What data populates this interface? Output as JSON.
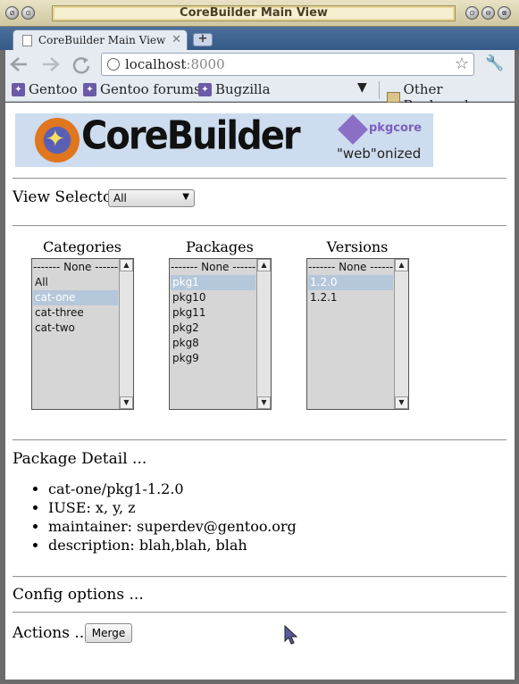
{
  "window": {
    "title": "CoreBuilder Main View",
    "wm_left_buttons": [
      "⊘",
      "⊙"
    ],
    "wm_right_buttons": [
      "⊙",
      "⊖",
      "⊗"
    ]
  },
  "tab": {
    "title": "CoreBuilder Main View",
    "close": "✕"
  },
  "newtab": {
    "label": "+"
  },
  "toolbar": {
    "url_host": "localhost",
    "url_port": ":8000",
    "back_icon": "back-arrow-icon",
    "forward_icon": "forward-arrow-icon",
    "reload_icon": "reload-icon"
  },
  "bookmarks": {
    "items": [
      "Gentoo",
      "Gentoo forums",
      "Bugzilla"
    ],
    "overflow": "▼",
    "other": "Other Bookmarks"
  },
  "banner": {
    "brand": "CoreBuilder",
    "pkgcore": "pkgcore",
    "tagline": "\"web\"onized"
  },
  "view_selector": {
    "label": "View Selector",
    "value": "All"
  },
  "categories": {
    "header": "Categories",
    "options": [
      "------- None -------",
      "All",
      "cat-one",
      "cat-three",
      "cat-two"
    ],
    "selected": "cat-one"
  },
  "packages": {
    "header": "Packages",
    "options": [
      "------- None -------",
      "pkg1",
      "pkg10",
      "pkg11",
      "pkg2",
      "pkg8",
      "pkg9"
    ],
    "selected": "pkg1"
  },
  "versions": {
    "header": "Versions",
    "options": [
      "------- None -------",
      "1.2.0",
      "1.2.1"
    ],
    "selected": "1.2.0"
  },
  "package_detail": {
    "heading": "Package Detail ...",
    "items": [
      "cat-one/pkg1-1.2.0",
      "IUSE: x, y, z",
      "maintainer: superdev@gentoo.org",
      "description: blah,blah, blah"
    ]
  },
  "config": {
    "heading": "Config options ..."
  },
  "actions": {
    "heading": "Actions ...",
    "merge_label": "Merge"
  },
  "colors": {
    "titlebar": "#e0d9b6",
    "tabstrip": "#3f6390",
    "banner_bg": "#cddcee",
    "selection": "#b5c7da"
  }
}
